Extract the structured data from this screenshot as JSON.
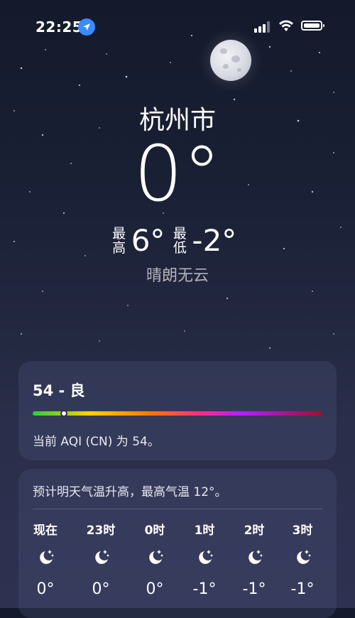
{
  "status_bar": {
    "time": "22:25"
  },
  "location": {
    "city": "杭州市"
  },
  "current": {
    "temperature": "0°",
    "high_label": "最高",
    "high": "6°",
    "low_label": "最低",
    "low": "-2°",
    "condition": "晴朗无云"
  },
  "aqi": {
    "title": "54 - 良",
    "description": "当前 AQI (CN) 为 54。",
    "level": 54
  },
  "forecast": {
    "note": "预计明天气温升高，最高气温 12°。",
    "hours": [
      {
        "label": "现在",
        "icon": "moon-stars-icon",
        "temp": "0°"
      },
      {
        "label": "23时",
        "icon": "moon-stars-icon",
        "temp": "0°"
      },
      {
        "label": "0时",
        "icon": "moon-stars-icon",
        "temp": "0°"
      },
      {
        "label": "1时",
        "icon": "moon-stars-icon",
        "temp": "-1°"
      },
      {
        "label": "2时",
        "icon": "moon-stars-icon",
        "temp": "-1°"
      },
      {
        "label": "3时",
        "icon": "moon-stars-icon",
        "temp": "-1°"
      }
    ]
  }
}
